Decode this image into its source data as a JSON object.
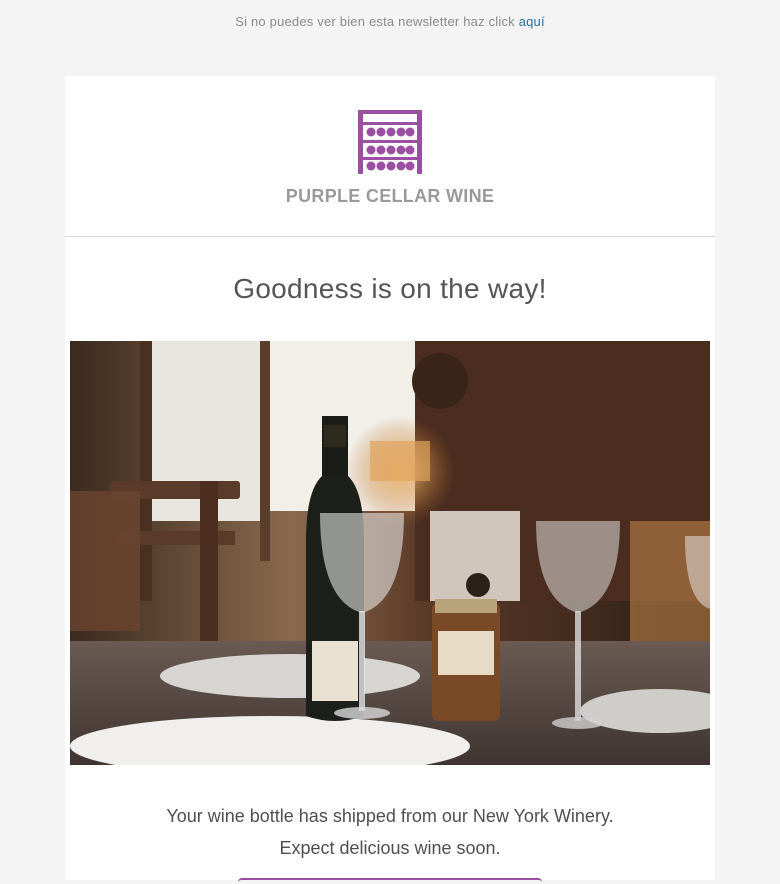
{
  "preheader": {
    "text": "Si no puedes ver bien esta newsletter haz click ",
    "link": "aquí"
  },
  "brand": {
    "name": "PURPLE CELLAR WINE",
    "icon": "wine-rack-icon",
    "accent_color": "#9b4fa3"
  },
  "headline": "Goodness is on the way!",
  "hero_image": {
    "icon": "wine-table-photo"
  },
  "body": {
    "line1": "Your wine bottle has shipped from our New York Winery.",
    "line2": "Expect delicious wine soon."
  }
}
